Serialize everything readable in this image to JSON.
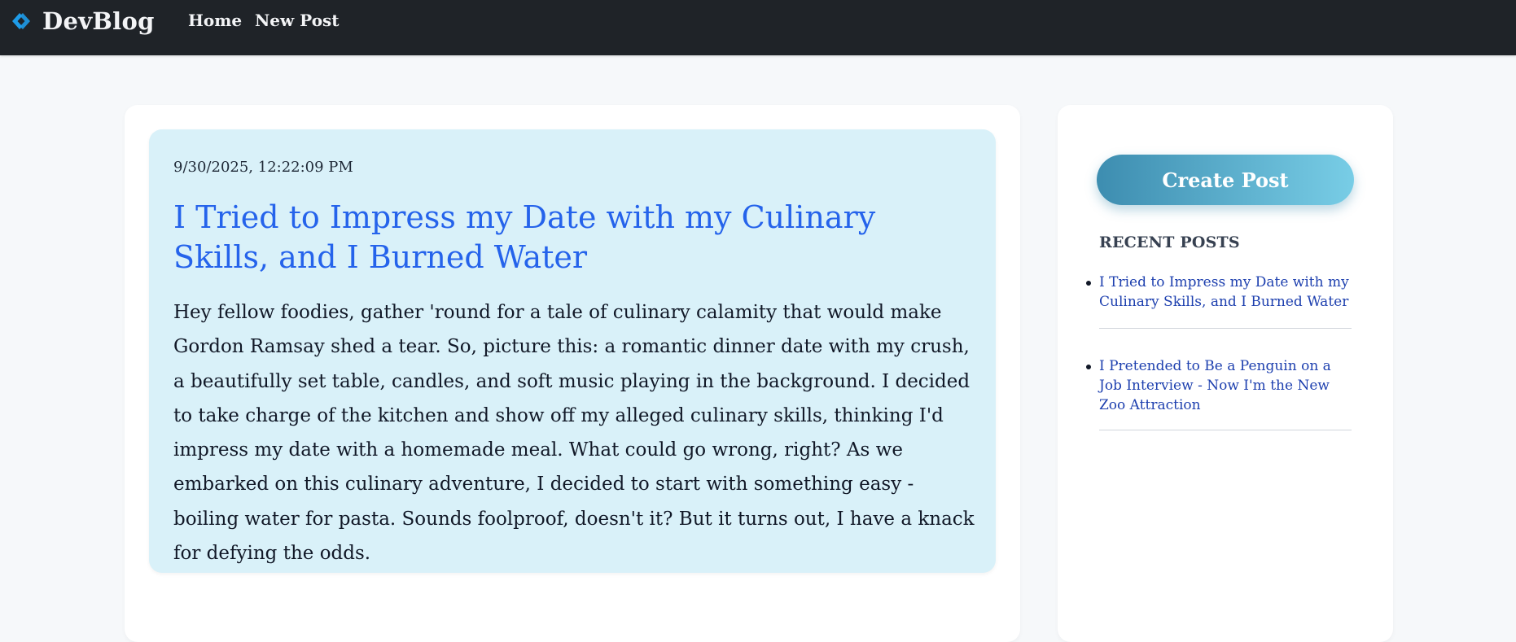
{
  "nav": {
    "brand": "DevBlog",
    "brand_icon": "code-chevrons-icon",
    "links": [
      "Home",
      "New Post"
    ]
  },
  "post": {
    "date": "9/30/2025, 12:22:09 PM",
    "title": "I Tried to Impress my Date with my Culinary Skills, and I Burned Water",
    "body": "Hey fellow foodies, gather 'round for a tale of culinary calamity that would make Gordon Ramsay shed a tear. So, picture this: a romantic dinner date with my crush, a beautifully set table, candles, and soft music playing in the background. I decided to take charge of the kitchen and show off my alleged culinary skills, thinking I'd impress my date with a homemade meal. What could go wrong, right? As we embarked on this culinary adventure, I decided to start with something easy - boiling water for pasta. Sounds foolproof, doesn't it? But it turns out, I have a knack for defying the odds."
  },
  "sidebar": {
    "create_label": "Create Post",
    "recent_heading": "RECENT POSTS",
    "recent_posts": [
      "I Tried to Impress my Date with my Culinary Skills, and I Burned Water",
      "I Pretended to Be a Penguin on a Job Interview - Now I'm the New Zoo Attraction"
    ]
  },
  "colors": {
    "navbar_bg": "#1f2328",
    "brand_icon": "#1e9be8",
    "post_card_bg": "#d9f1f9",
    "post_title": "#2563eb",
    "recent_link": "#1e40af",
    "button_gradient_start": "#3d8db0",
    "button_gradient_end": "#78cde6"
  }
}
